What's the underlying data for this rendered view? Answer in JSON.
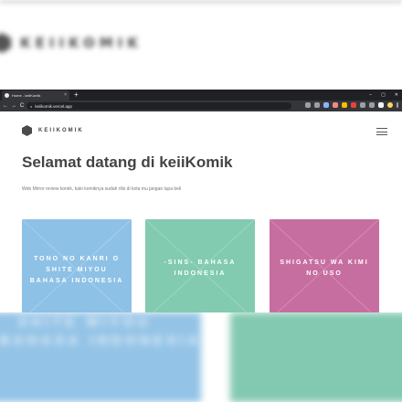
{
  "browser": {
    "tab_title": "Home - keiiKomik",
    "tab_close": "×",
    "new_tab": "+",
    "window_controls": [
      "–",
      "▢",
      "✕"
    ],
    "nav_back": "←",
    "nav_forward": "→",
    "nav_reload": "C",
    "url": "keiikomik.vercel.app"
  },
  "site": {
    "brand": "KEIIKOMIK",
    "headline": "Selamat datang di keiiKomik",
    "description": "Web Mirror review komik, kalo komiknya sudah rilis di kota mu jangan lupa beli"
  },
  "cards": [
    {
      "title": "TONO NO KANRI O SHITE MIYOU BAHASA INDONESIA",
      "color": "#8ec1e6"
    },
    {
      "title": "-SINS- BAHASA INDONESIA",
      "color": "#82cbb0"
    },
    {
      "title": "SHIGATSU WA KIMI NO USO",
      "color": "#c76ea0"
    }
  ]
}
